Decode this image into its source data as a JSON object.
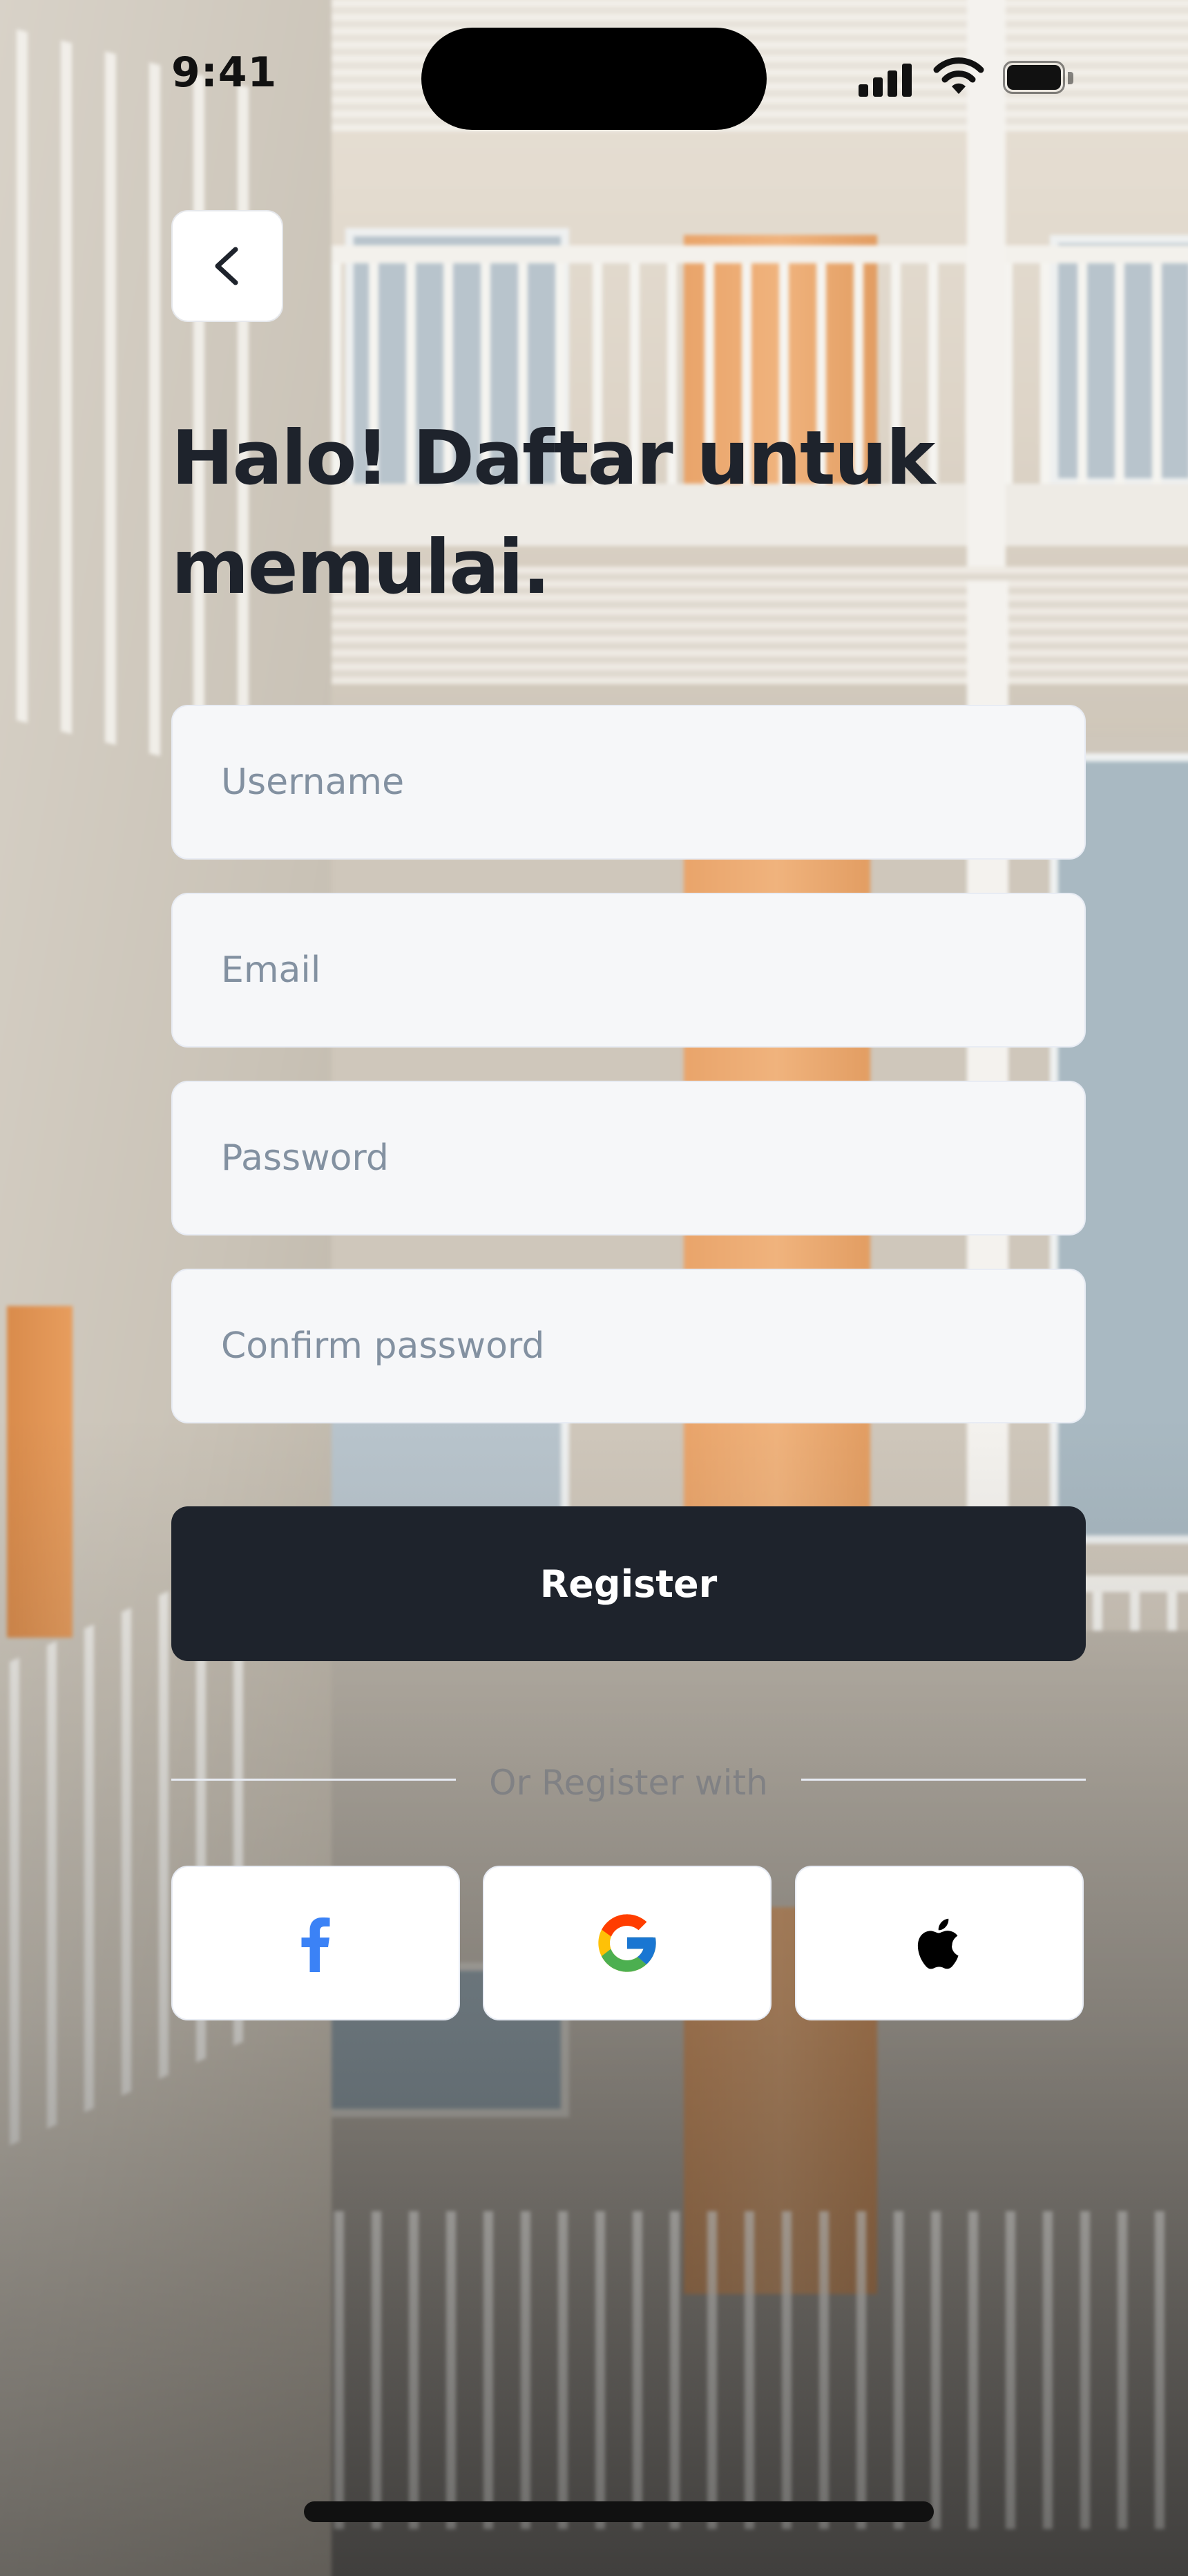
{
  "status_bar": {
    "time": "9:41",
    "icons": [
      "signal-icon",
      "wifi-icon",
      "battery-icon"
    ]
  },
  "navigation": {
    "back_icon": "chevron-left-icon"
  },
  "header": {
    "title": "Halo! Daftar untuk memulai."
  },
  "form": {
    "username_placeholder": "Username",
    "email_placeholder": "Email",
    "password_placeholder": "Password",
    "confirm_password_placeholder": "Confirm password",
    "register_label": "Register"
  },
  "social": {
    "divider_text": "Or Register with",
    "providers": [
      "facebook-icon",
      "google-icon",
      "apple-icon"
    ]
  },
  "colors": {
    "primary_dark": "#1E232C",
    "field_bg": "#F6F7F9",
    "placeholder": "#8391A1",
    "facebook_blue": "#3B82F6"
  }
}
